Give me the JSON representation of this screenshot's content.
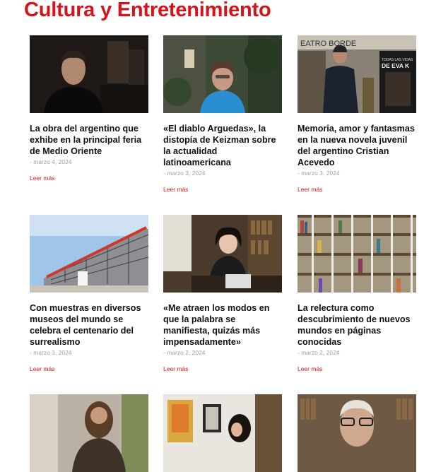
{
  "section": {
    "title": "Cultura y Entretenimiento"
  },
  "articles": [
    {
      "title": "La obra del argentino que exhibe en la principal feria de Medio Oriente",
      "date": "- marzo 4, 2024",
      "more": "Leer más"
    },
    {
      "title": "«El diablo Arguedas», la distopía de Keizman sobre la actualidad latinoamericana",
      "date": "- marzo 3, 2024",
      "more": "Leer más"
    },
    {
      "title": "Memoria, amor y fantasmas en la nueva novela juvenil del argentino Cristian Acevedo",
      "date": "- marzo 3, 2024",
      "more": "Leer más"
    },
    {
      "title": "Con muestras en diversos museos del mundo se celebra el centenario del surrealismo",
      "date": "- marzo 3, 2024",
      "more": "Leer más"
    },
    {
      "title": "«Me atraen los modos en que la palabra se manifiesta, quizás más impensadamente»",
      "date": "- marzo 2, 2024",
      "more": "Leer más"
    },
    {
      "title": "La relectura como descubrimiento de nuevos mundos en páginas conocidas",
      "date": "- marzo 2, 2024",
      "more": "Leer más"
    }
  ],
  "signage": {
    "theater": "EATRO BORDE",
    "poster_top": "TODAS LAS VIDAS",
    "poster_main": "DE EVA K"
  },
  "colors": {
    "accent": "#d3141a",
    "title": "#111111",
    "date": "#a0a0a0"
  }
}
